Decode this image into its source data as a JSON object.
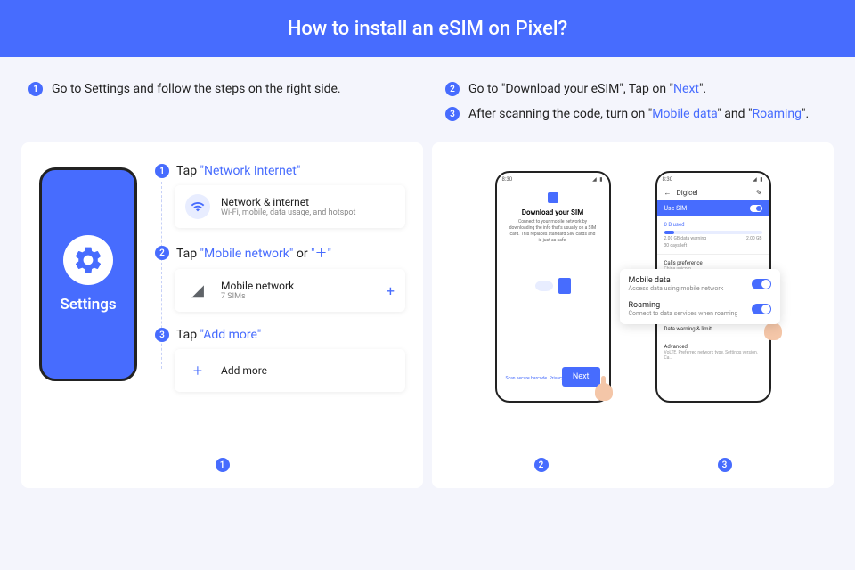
{
  "title": "How to install an eSIM on Pixel?",
  "intro": {
    "left": [
      {
        "n": "1",
        "text": "Go to Settings and follow the steps on the right side."
      }
    ],
    "right": [
      {
        "n": "2",
        "pre": "Go to \"Download your eSIM\", Tap on \"",
        "link": "Next",
        "post": "\"."
      },
      {
        "n": "3",
        "pre": "After scanning the code, turn on \"",
        "link1": "Mobile data",
        "mid": "\" and \"",
        "link2": "Roaming",
        "post": "\"."
      }
    ]
  },
  "settingsPhone": {
    "label": "Settings"
  },
  "steps": [
    {
      "n": "1",
      "tap": "Tap ",
      "hl": "\"Network Internet\"",
      "card": {
        "title": "Network & internet",
        "sub": "Wi-Fi, mobile, data usage, and hotspot"
      }
    },
    {
      "n": "2",
      "tap": "Tap ",
      "hl": "\"Mobile network\"",
      "or": " or ",
      "hl2": "\"＋\"",
      "card": {
        "title": "Mobile network",
        "sub": "7 SIMs",
        "plus": "+"
      }
    },
    {
      "n": "3",
      "tap": "Tap ",
      "hl": "\"Add more\"",
      "card": {
        "title": "Add more",
        "plus": "+"
      }
    }
  ],
  "badges": {
    "left": "1",
    "mid": "2",
    "right": "3"
  },
  "phone2": {
    "time": "8:30",
    "title": "Download your SIM",
    "desc": "Connect to your mobile network by downloading the info that's usually on a SIM card. This replaces standard SIM cards and is just as safe.",
    "privacy": "Scan secure barcode. Privacy path",
    "next": "Next"
  },
  "phone3": {
    "time": "8:30",
    "carrier": "Digicel",
    "useSim": "Use SIM",
    "meterLabel": "0 B used",
    "meterLeft": "2.00 GB data warning",
    "meterRight": "2.00 GB",
    "days": "30 days left",
    "rows": [
      {
        "title": "Calls preference",
        "sub": "China unicom"
      },
      {
        "title": "Data warning & limit"
      },
      {
        "title": "Advanced",
        "sub": "VoLTE, Preferred network type, Settings version, Ca..."
      }
    ]
  },
  "popup": {
    "r1": {
      "title": "Mobile data",
      "sub": "Access data using mobile network"
    },
    "r2": {
      "title": "Roaming",
      "sub": "Connect to data services when roaming"
    }
  }
}
